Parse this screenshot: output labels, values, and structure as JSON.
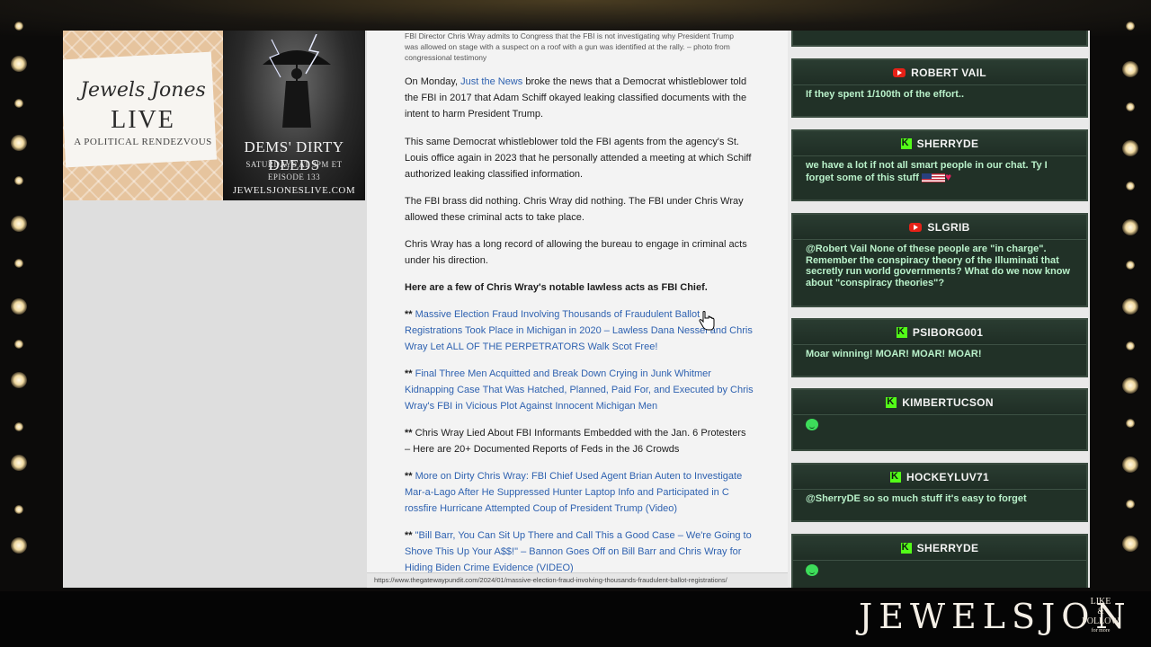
{
  "overlay": {
    "show_logo": "Jewels Jones",
    "show_live": "LIVE",
    "tagline": "A POLITICAL RENDEZVOUS",
    "episode_title": "DEMS' DIRTY DEEDS",
    "schedule": "SATURDAYS AT 3PM ET",
    "episode": "EPISODE 133",
    "site": "JEWELSJONESLIVE.COM"
  },
  "branding": {
    "logo": "JEWELSJON",
    "like": "LIKE",
    "amp": "&",
    "follow": "FOLLOW",
    "for_more": "for more"
  },
  "article": {
    "caption": "FBI Director Chris Wray admits to Congress that the FBI is not investigating why President Trump was allowed on stage with a suspect on a roof with a gun was identified at the rally. – photo from congressional testimony",
    "p1_before": "On Monday, ",
    "p1_link": "Just the News",
    "p1_after": " broke the news that a Democrat whistleblower told the FBI in 2017 that Adam Schiff okayed leaking classified documents with the intent to harm President Trump.",
    "p2": "This same Democrat whistleblower told the FBI agents from the agency's St. Louis office again in 2023 that he personally attended a meeting at which Schiff authorized leaking classified information.",
    "p3": "The FBI brass did nothing. Chris Wray did nothing. The FBI under Chris Wray allowed these criminal acts to take place.",
    "p4": "Chris Wray has a long record of allowing the bureau to engage in criminal acts under his direction.",
    "p5": "Here are a few of Chris Wray's notable lawless acts as FBI Chief.",
    "bullet": "** ",
    "items": [
      {
        "text": "Massive Election Fraud Involving Thousands of Fraudulent Ballot Registrations Took Place in Michigan in 2020 – Lawless Dana Nessel and Chris Wray Let ALL OF THE PERPETRATORS Walk Scot Free!"
      },
      {
        "text": "Final Three Men Acquitted and Break Down Crying in Junk Whitmer Kidnapping Case That Was Hatched, Planned, Paid For, and Executed by Chris Wray's FBI in Vicious Plot Against Innocent Michigan Men"
      },
      {
        "text": "Chris Wray Lied About FBI Informants Embedded with the Jan. 6 Protesters – Here are 20+ Documented Reports of Feds in the J6 Crowds"
      },
      {
        "text": "More on Dirty Chris Wray: FBI Chief Used Agent Brian Auten to Investigate Mar-a-Lago After He Suppressed Hunter Laptop Info and Participated in C rossfire Hurricane Attempted Coup of President Trump (Video)"
      },
      {
        "text": "\"Bill Barr, You Can Sit Up There and Call This a Good Case – We're Going to Shove This Up Your A$$!\" – Bannon Goes Off on Bill Barr and Chris Wray for Hiding Biden Crime Evidence (VIDEO)"
      }
    ],
    "status_url": "https://www.thegatewaypundit.com/2024/01/massive-election-fraud-involving-thousands-fraudulent-ballot-registrations/"
  },
  "chat": {
    "messages": [
      {
        "platform": "youtube",
        "user": "ROBERT VAIL",
        "text": "If they spent 1/100th of the effort.."
      },
      {
        "platform": "kick",
        "user": "SHERRYDE",
        "text": "we have a lot if not all smart people in our chat. Ty I forget some of this stuff"
      },
      {
        "platform": "youtube",
        "user": "SLGRIB",
        "text": "@Robert Vail None of these people are \"in charge\". Remember the conspiracy theory of the Illuminati that secretly run world governments? What do we now know about \"conspiracy theories\"?"
      },
      {
        "platform": "kick",
        "user": "PSIBORG001",
        "text": "Moar winning! MOAR! MOAR! MOAR!"
      },
      {
        "platform": "kick",
        "user": "KIMBERTUCSON",
        "text": ""
      },
      {
        "platform": "kick",
        "user": "HOCKEYLUV71",
        "text": "@SherryDE so so much stuff it's easy to forget"
      },
      {
        "platform": "kick",
        "user": "SHERRYDE",
        "text": ""
      }
    ]
  },
  "colors": {
    "link": "#2f62b0",
    "chat_card": "#213127",
    "chat_text": "#b9f1ca",
    "youtube": "#e62117",
    "kick": "#53fc18"
  }
}
